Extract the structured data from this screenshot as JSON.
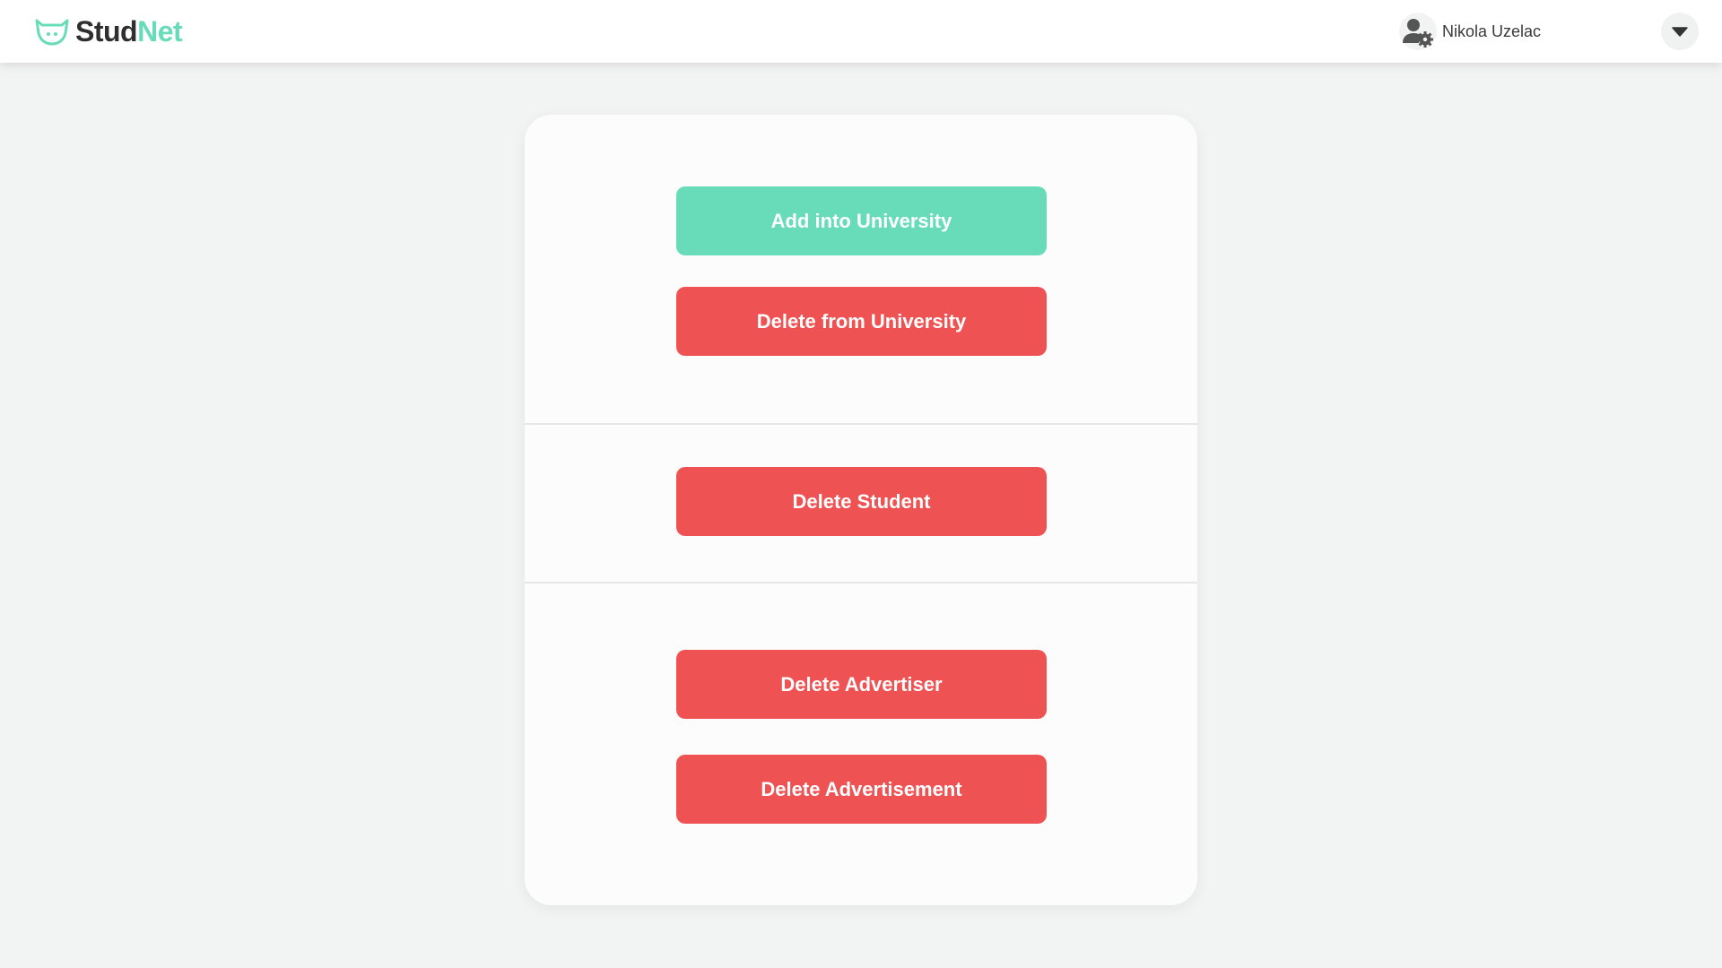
{
  "header": {
    "logo_text_dark": "Stud",
    "logo_text_accent": "Net",
    "user_name": "Nikola Uzelac",
    "user_icon": "user-gear-icon",
    "dropdown_icon": "caret-down-icon"
  },
  "panel": {
    "add_university_label": "Add into University",
    "delete_university_label": "Delete from University",
    "delete_student_label": "Delete Student",
    "delete_advertiser_label": "Delete Advertiser",
    "delete_advertisement_label": "Delete Advertisement"
  },
  "colors": {
    "accent_green": "#68dcb8",
    "danger_red": "#ee5253",
    "background": "#f1f4f3"
  }
}
